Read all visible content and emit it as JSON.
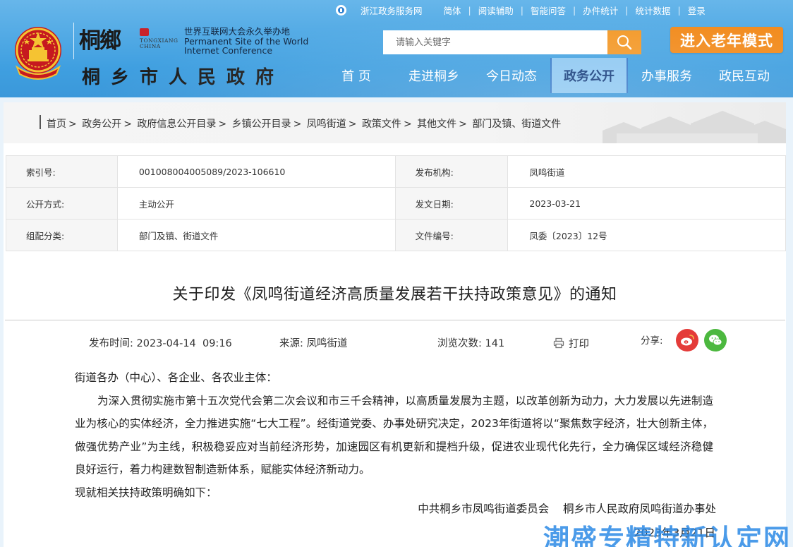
{
  "topbar": {
    "zj_service": "浙江政务服务网",
    "simplified": "简体",
    "reading_aid": "阅读辅助",
    "ai_qa": "智能问答",
    "task_stats": "办件统计",
    "stats_data": "统计数据",
    "login": "登录"
  },
  "logo": {
    "calligraphy": "桐鄉",
    "sub_latin": "TONGXIANG\nCHINA",
    "wic_cn": "世界互联网大会永久举办地",
    "wic_en1": "Permanent Site of the World",
    "wic_en2": "Internet Conference",
    "site_name": "桐乡市人民政府"
  },
  "search": {
    "placeholder": "请输入关键字"
  },
  "elder_mode": "进入老年模式",
  "nav": [
    "首 页",
    "走进桐乡",
    "今日动态",
    "政务公开",
    "办事服务",
    "政民互动"
  ],
  "nav_active_index": 3,
  "breadcrumb": [
    "首页",
    "政务公开",
    "政府信息公开目录",
    "乡镇公开目录",
    "凤鸣街道",
    "政策文件",
    "其他文件",
    "部门及镇、街道文件"
  ],
  "meta": {
    "index_label": "索引号:",
    "index_value": "001008004005089/2023-106610",
    "org_label": "发布机构:",
    "org_value": "凤鸣街道",
    "method_label": "公开方式:",
    "method_value": "主动公开",
    "date_label": "发文日期:",
    "date_value": "2023-03-21",
    "category_label": "组配分类:",
    "category_value": "部门及镇、街道文件",
    "docno_label": "文件编号:",
    "docno_value": "凤委〔2023〕12号"
  },
  "doc": {
    "title": "关于印发《凤鸣街道经济高质量发展若干扶持政策意见》的通知",
    "publish_time_label": "发布时间:",
    "publish_time": "2023-04-14  09:16",
    "source_label": "来源:",
    "source": "凤鸣街道",
    "views_label": "浏览次数:",
    "views": "141",
    "print": "打印",
    "share_label": "分享:",
    "salutation": "街道各办（中心）、各企业、各农业主体：",
    "paragraph1": "为深入贯彻实施市第十五次党代会第二次会议和市三千会精神，以高质量发展为主题，以改革创新为动力，大力发展以先进制造业为核心的实体经济，全力推进实施“七大工程”。经街道党委、办事处研究决定，2023年街道将以“聚焦数字经济，壮大创新主体，做强优势产业”为主线，积极稳妥应对当前经济形势，加速园区有机更新和提档升级，促进农业现代化先行，全力确保区域经济稳健良好运行，着力构建数智制造新体系，赋能实体经济新动力。",
    "paragraph2": "现就相关扶持政策明确如下：",
    "signer": "中共桐乡市凤鸣街道委员会    桐乡市人民政府凤鸣街道办事处",
    "sign_date": "2023年3月21日"
  },
  "watermark": "潮盛专精特新认定网",
  "colors": {
    "header_blue": "#3f9fe0",
    "accent_orange": "#f28c1f",
    "nav_active_bg": "#8ec8f2",
    "weibo_red": "#e43b39",
    "wechat_green": "#4cb83f"
  },
  "icons": [
    "zj-service-icon",
    "national-emblem-icon",
    "search-icon",
    "print-icon",
    "weibo-icon",
    "wechat-icon"
  ]
}
